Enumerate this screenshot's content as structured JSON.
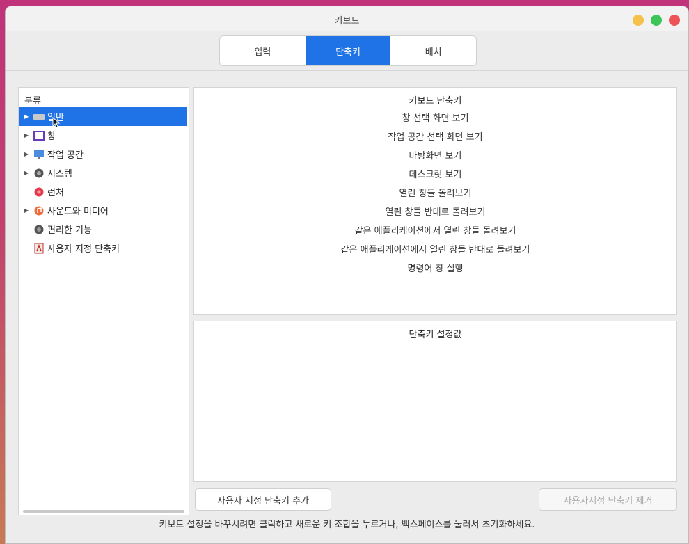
{
  "window": {
    "title": "키보드"
  },
  "tabs": [
    {
      "label": "입력",
      "selected": false
    },
    {
      "label": "단축키",
      "selected": true
    },
    {
      "label": "배치",
      "selected": false
    }
  ],
  "sidebar": {
    "header": "분류",
    "items": [
      {
        "label": "일반",
        "icon": "general-icon",
        "expandable": true,
        "selected": true
      },
      {
        "label": "창",
        "icon": "window-icon",
        "expandable": true,
        "selected": false
      },
      {
        "label": "작업 공간",
        "icon": "workspace-icon",
        "expandable": true,
        "selected": false
      },
      {
        "label": "시스템",
        "icon": "system-icon",
        "expandable": true,
        "selected": false
      },
      {
        "label": "런처",
        "icon": "launcher-icon",
        "expandable": false,
        "selected": false
      },
      {
        "label": "사운드와 미디어",
        "icon": "sound-media-icon",
        "expandable": true,
        "selected": false
      },
      {
        "label": "편리한 기능",
        "icon": "accessibility-icon",
        "expandable": false,
        "selected": false
      },
      {
        "label": "사용자 지정 단축키",
        "icon": "custom-shortcut-icon",
        "expandable": false,
        "selected": false
      }
    ]
  },
  "shortcuts_panel": {
    "title": "키보드 단축키",
    "items": [
      "창 선택 화면 보기",
      "작업 공간 선택 화면 보기",
      "바탕화면 보기",
      "데스크릿 보기",
      "열린 창들 돌려보기",
      "열린 창들 반대로 돌려보기",
      "같은 애플리케이션에서 열린 창들 돌려보기",
      "같은 애플리케이션에서 열린 창들 반대로 돌려보기",
      "명령어 창 실행"
    ]
  },
  "values_panel": {
    "title": "단축키 설정값"
  },
  "buttons": {
    "add": "사용자 지정 단축키 추가",
    "remove": "사용자지정 단축키 제거"
  },
  "hint": "키보드 설정을 바꾸시려면 클릭하고 새로운 키 조합을 누르거나, 백스페이스를 눌러서 초기화하세요.",
  "colors": {
    "accent": "#1f73e6"
  }
}
